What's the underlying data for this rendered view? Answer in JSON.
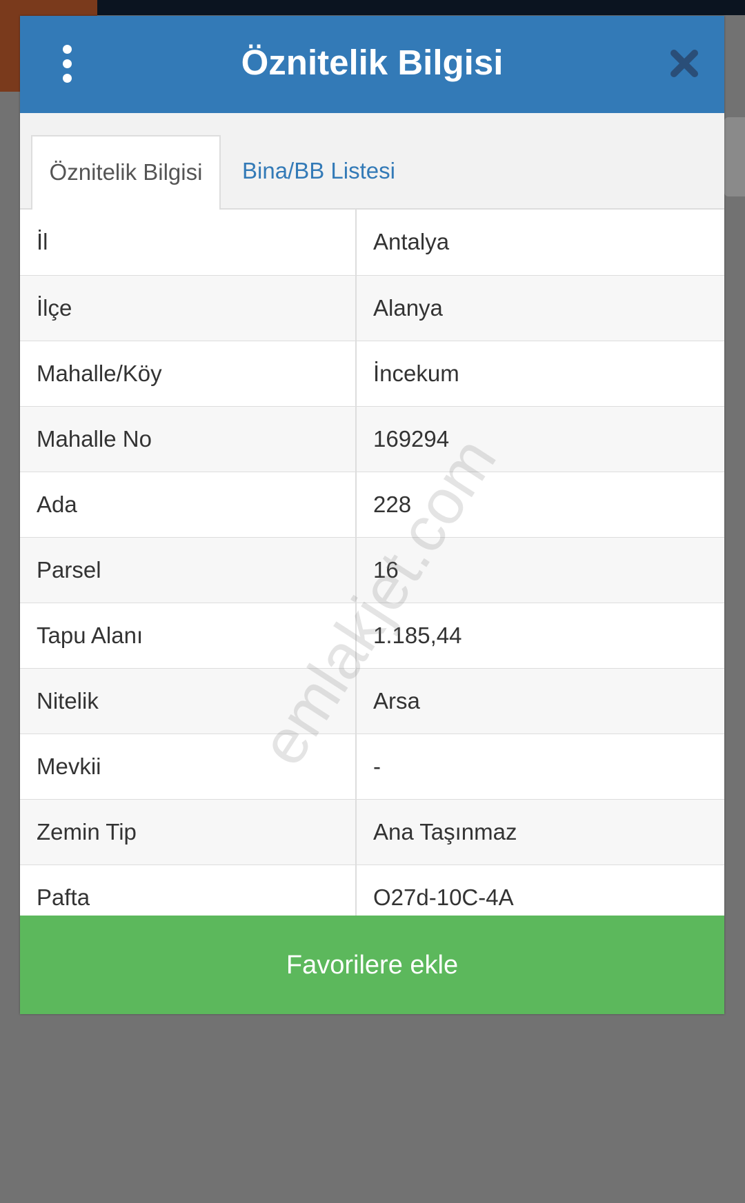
{
  "dialog": {
    "title": "Öznitelik Bilgisi"
  },
  "tabs": [
    {
      "label": "Öznitelik Bilgisi",
      "active": true
    },
    {
      "label": "Bina/BB Listesi",
      "active": false
    }
  ],
  "attributes": [
    {
      "label": "İl",
      "value": "Antalya"
    },
    {
      "label": "İlçe",
      "value": "Alanya"
    },
    {
      "label": "Mahalle/Köy",
      "value": "İncekum"
    },
    {
      "label": "Mahalle No",
      "value": "169294"
    },
    {
      "label": "Ada",
      "value": "228"
    },
    {
      "label": "Parsel",
      "value": "16"
    },
    {
      "label": "Tapu Alanı",
      "value": "1.185,44"
    },
    {
      "label": "Nitelik",
      "value": "Arsa"
    },
    {
      "label": "Mevkii",
      "value": "-"
    },
    {
      "label": "Zemin Tip",
      "value": "Ana Taşınmaz"
    },
    {
      "label": "Pafta",
      "value": "O27d-10C-4A"
    }
  ],
  "footer": {
    "favorite_label": "Favorilere ekle"
  },
  "watermark": "emlakjet.com",
  "colors": {
    "header": "#337ab7",
    "button": "#5cb85c",
    "close_icon": "#2a4e78"
  },
  "icons": {
    "menu": "vertical-dots-icon",
    "close": "close-icon"
  }
}
